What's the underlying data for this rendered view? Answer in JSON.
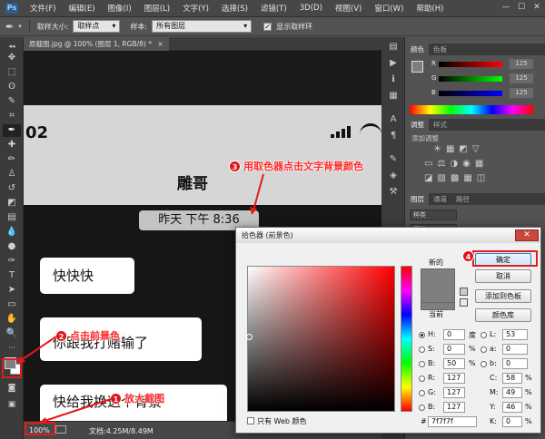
{
  "app": {
    "logo": "Ps"
  },
  "menu": [
    "文件(F)",
    "编辑(E)",
    "图像(I)",
    "图层(L)",
    "文字(Y)",
    "选择(S)",
    "滤镜(T)",
    "3D(D)",
    "视图(V)",
    "窗口(W)",
    "帮助(H)"
  ],
  "window_buttons": [
    "—",
    "☐",
    "✕"
  ],
  "options": {
    "sample_size_label": "取样大小:",
    "sample_size_value": "取样点",
    "sample_label": "样本:",
    "sample_value": "所有图层",
    "show_ring_label": "显示取样环"
  },
  "document": {
    "tab_title": "原截图.jpg @ 100% (图层 1, RGB/8) *",
    "tab_close": "×"
  },
  "canvas": {
    "time_partial": "02",
    "contact_name": "雕哥",
    "timestamp": "昨天 下午 8:36",
    "messages": [
      "快快快",
      "你跟我打赌输了",
      "快给我换这个背景"
    ]
  },
  "status": {
    "zoom": "100%",
    "doc_info": "文档:4.25M/8.49M"
  },
  "panels": {
    "color_tabs": [
      "颜色",
      "色板"
    ],
    "rgb_labels": [
      "R",
      "G",
      "B"
    ],
    "rgb_values": [
      "125",
      "125",
      "125"
    ],
    "adjust_tabs": [
      "调整",
      "样式"
    ],
    "adjust_label": "添加调整",
    "layers_tabs": [
      "图层",
      "通道",
      "路径"
    ],
    "layers_kind": "正常"
  },
  "dialog": {
    "title": "拾色器 (前景色)",
    "ok": "确定",
    "cancel": "取消",
    "add_to_swatches": "添加到色板",
    "color_libraries": "颜色库",
    "new_label": "新的",
    "current_label": "当前",
    "color_hex": "#7f7f7f",
    "H": {
      "label": "H:",
      "value": "0",
      "unit": "度"
    },
    "S": {
      "label": "S:",
      "value": "0",
      "unit": "%"
    },
    "B": {
      "label": "B:",
      "value": "50",
      "unit": "%"
    },
    "R": {
      "label": "R:",
      "value": "127"
    },
    "G": {
      "label": "G:",
      "value": "127"
    },
    "Bb": {
      "label": "B:",
      "value": "127"
    },
    "L": {
      "label": "L:",
      "value": "53"
    },
    "a": {
      "label": "a:",
      "value": "0"
    },
    "b": {
      "label": "b:",
      "value": "0"
    },
    "C": {
      "label": "C:",
      "value": "58",
      "unit": "%"
    },
    "M": {
      "label": "M:",
      "value": "49",
      "unit": "%"
    },
    "Y": {
      "label": "Y:",
      "value": "46",
      "unit": "%"
    },
    "K": {
      "label": "K:",
      "value": "0",
      "unit": "%"
    },
    "hex_label": "#",
    "hex_value": "7f7f7f",
    "web_only_label": "只有 Web 颜色"
  },
  "annotations": {
    "step1": {
      "num": "1",
      "text": "放大截图"
    },
    "step2": {
      "num": "2",
      "text": "点击前景色"
    },
    "step3": {
      "num": "3",
      "text": "用取色器点击文字背景颜色"
    },
    "step4": {
      "num": "4"
    }
  }
}
